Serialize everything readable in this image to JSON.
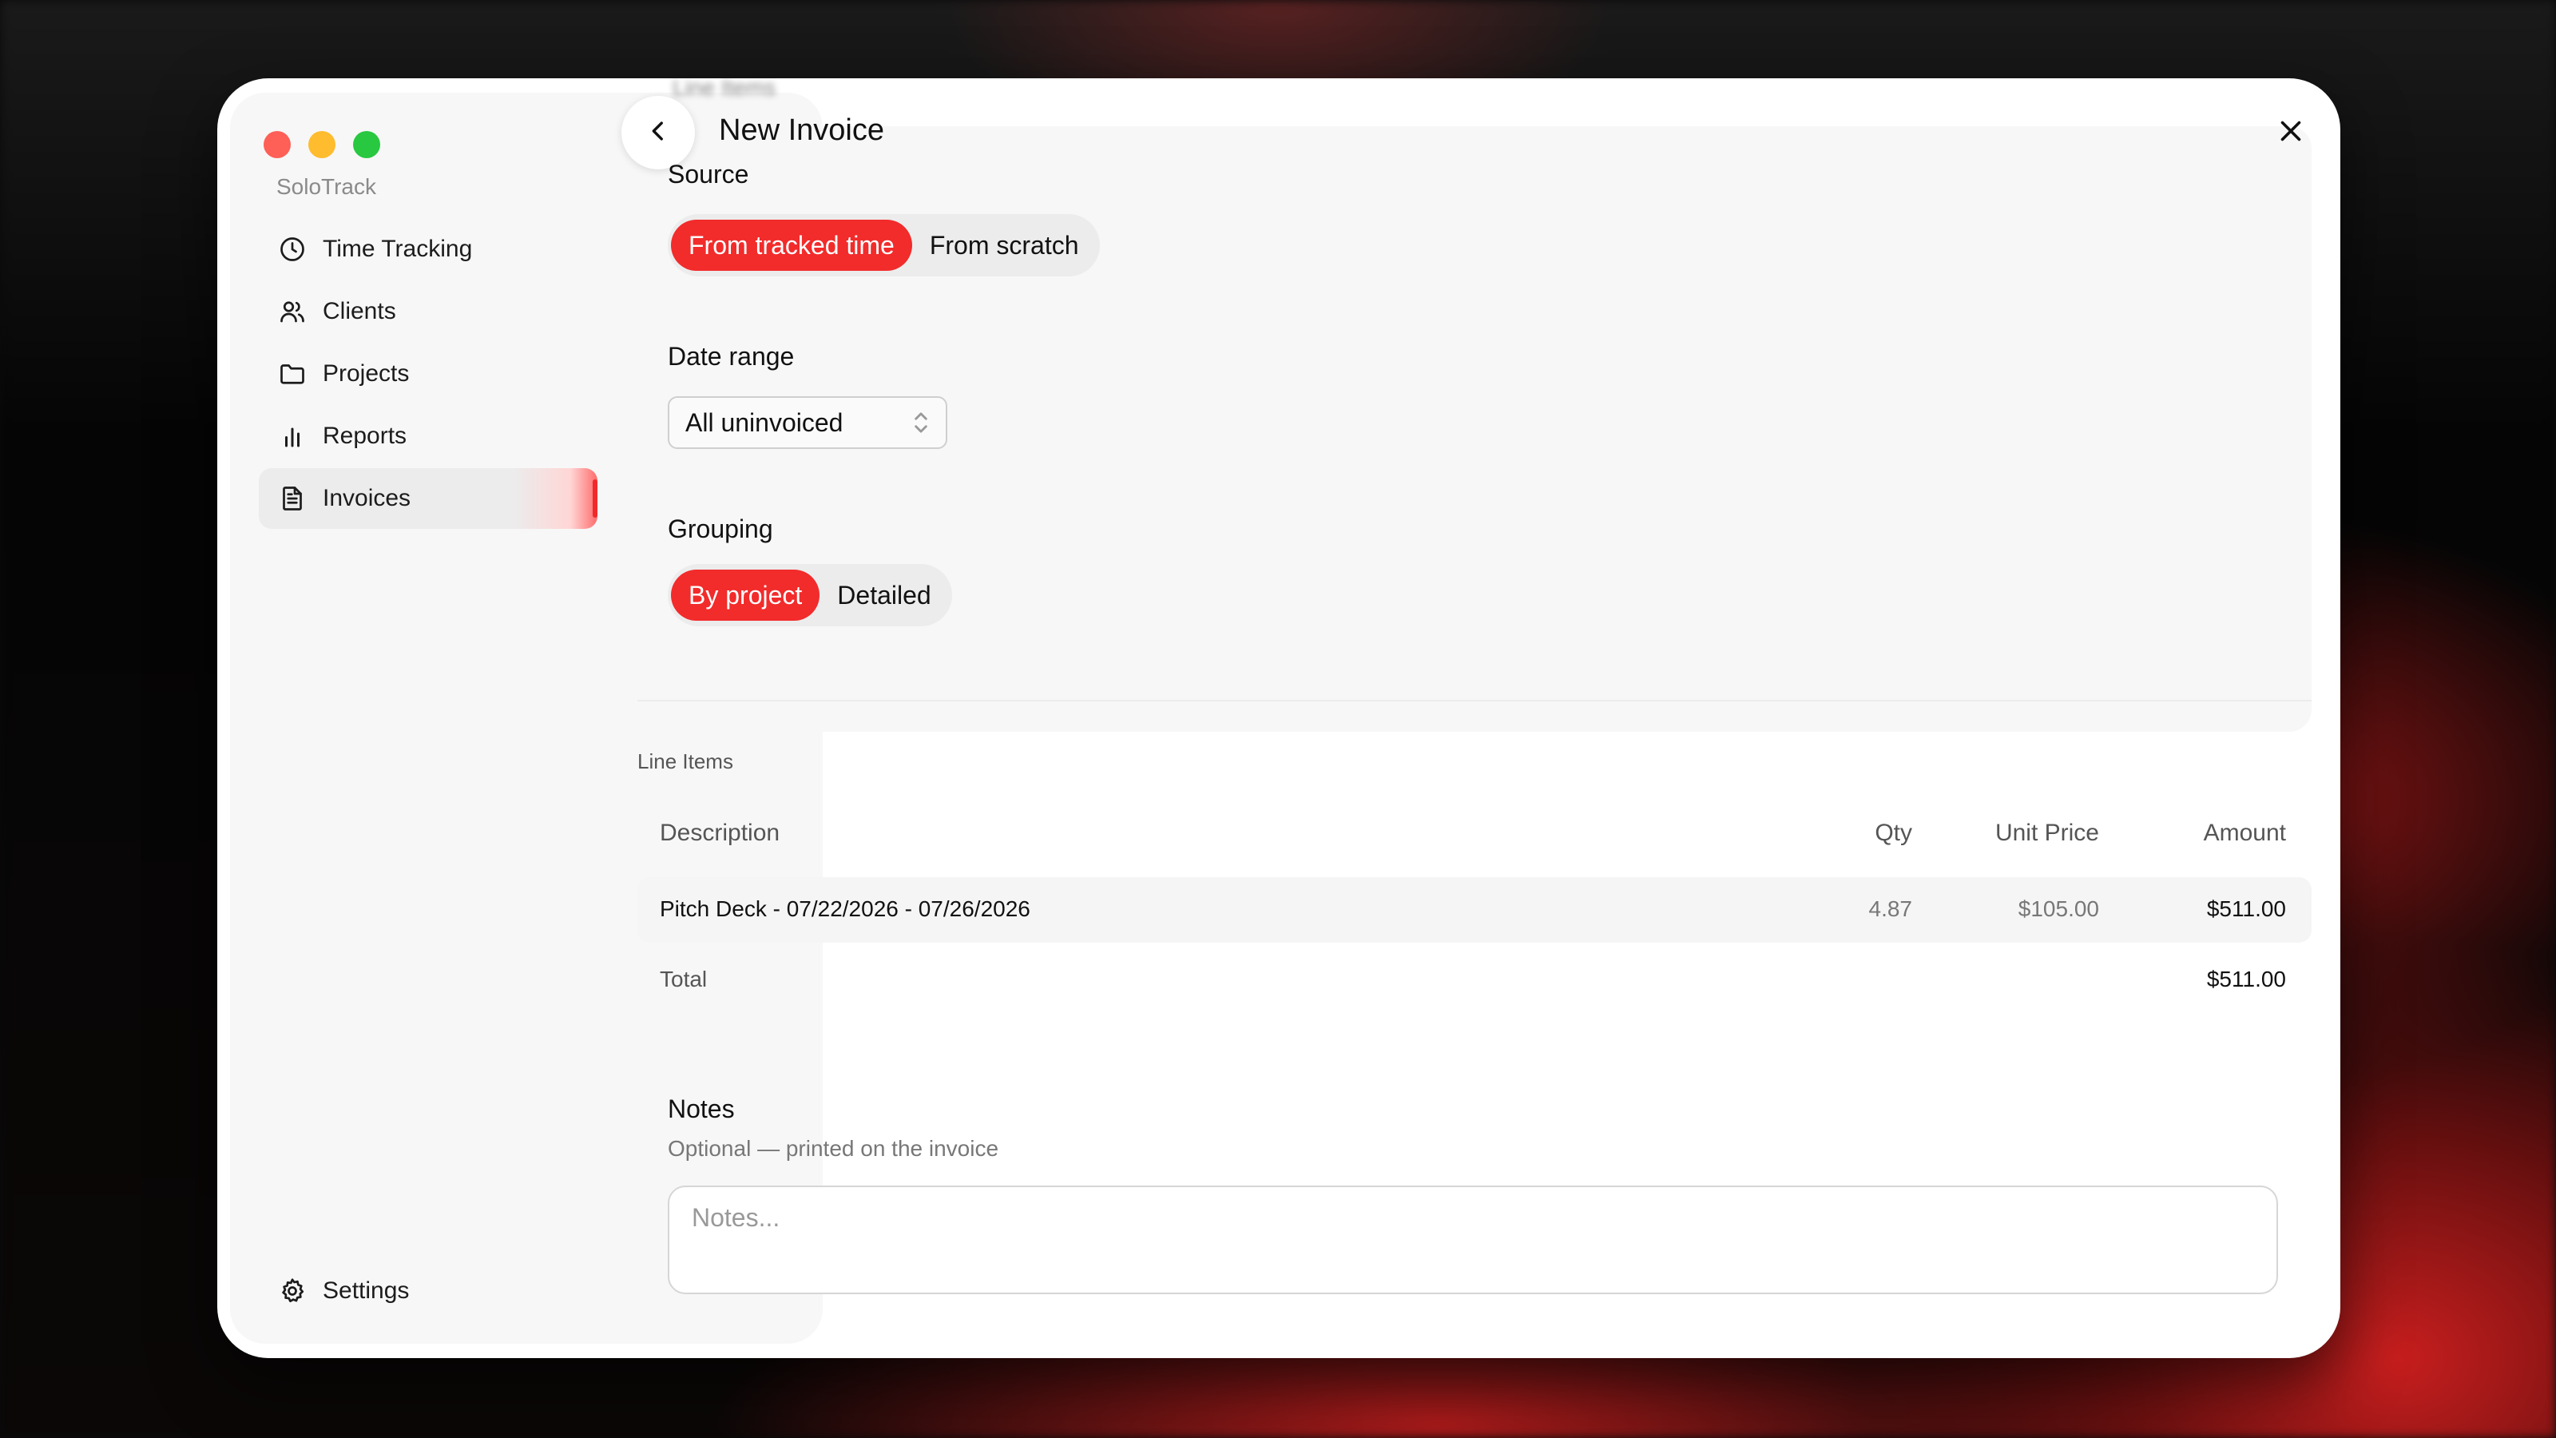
{
  "app": {
    "name": "SoloTrack"
  },
  "sidebar": {
    "items": [
      {
        "label": "Time Tracking",
        "icon": "clock-icon"
      },
      {
        "label": "Clients",
        "icon": "users-icon"
      },
      {
        "label": "Projects",
        "icon": "folder-icon"
      },
      {
        "label": "Reports",
        "icon": "bar-chart-icon"
      },
      {
        "label": "Invoices",
        "icon": "document-icon",
        "active": true
      }
    ],
    "settings_label": "Settings",
    "accent": "#f02a2a"
  },
  "header": {
    "title": "New Invoice",
    "ghost_title": "Line Items"
  },
  "form": {
    "source": {
      "label": "Source",
      "options": [
        "From tracked time",
        "From scratch"
      ],
      "selected": "From tracked time"
    },
    "date_range": {
      "label": "Date range",
      "value": "All uninvoiced"
    },
    "grouping": {
      "label": "Grouping",
      "options": [
        "By project",
        "Detailed"
      ],
      "selected": "By project"
    }
  },
  "line_items": {
    "title": "Line Items",
    "columns": [
      "Description",
      "Qty",
      "Unit Price",
      "Amount"
    ],
    "rows": [
      {
        "description": "Pitch Deck - 07/22/2026 - 07/26/2026",
        "qty": "4.87",
        "unit_price": "$105.00",
        "amount": "$511.00"
      }
    ],
    "total_label": "Total",
    "total_value": "$511.00"
  },
  "notes": {
    "title": "Notes",
    "subtitle": "Optional — printed on the invoice",
    "placeholder": "Notes..."
  },
  "colors": {
    "accent": "#f22b2b",
    "traffic_red": "#fe5f57",
    "traffic_yellow": "#febc2e",
    "traffic_green": "#28c840"
  }
}
